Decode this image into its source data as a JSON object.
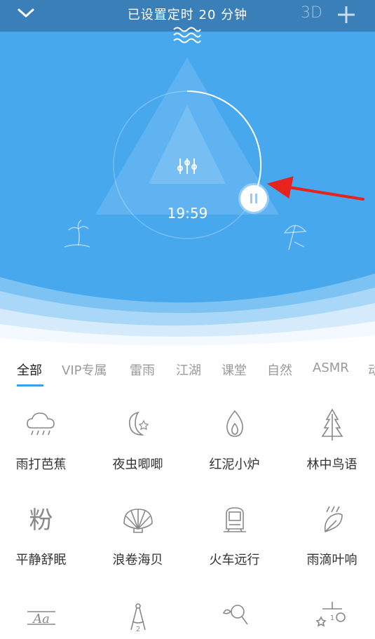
{
  "header": {
    "title": "已设置定时 20 分钟",
    "btn_3d": "3D"
  },
  "player": {
    "time": "19:59"
  },
  "tabs": [
    {
      "label": "全部",
      "active": true
    },
    {
      "label": "VIP专属"
    },
    {
      "label": "雷雨"
    },
    {
      "label": "江湖"
    },
    {
      "label": "课堂"
    },
    {
      "label": "自然"
    },
    {
      "label": "ASMR"
    },
    {
      "label": "动"
    }
  ],
  "sounds": [
    {
      "label": "雨打芭蕉",
      "icon": "cloud-rain-icon"
    },
    {
      "label": "夜虫唧唧",
      "icon": "moon-stars-icon"
    },
    {
      "label": "红泥小炉",
      "icon": "flame-icon"
    },
    {
      "label": "林中鸟语",
      "icon": "pine-tree-icon"
    },
    {
      "label": "平静舒眠",
      "icon": "fen-character-icon",
      "glyph": "粉"
    },
    {
      "label": "浪卷海贝",
      "icon": "seashell-icon"
    },
    {
      "label": "火车远行",
      "icon": "train-icon"
    },
    {
      "label": "雨滴叶响",
      "icon": "rain-leaf-icon"
    },
    {
      "label": "",
      "icon": "handwriting-icon",
      "glyph": "Aa"
    },
    {
      "label": "",
      "icon": "compass-icon",
      "glyph": "2"
    },
    {
      "label": "",
      "icon": "magnifier-icon"
    },
    {
      "label": "",
      "icon": "mobile-toy-icon",
      "glyph": "1"
    }
  ],
  "colors": {
    "hero_blue": "#47a8ee",
    "topbar_blue": "#3b7fb8",
    "accent": "#3aa0ec"
  },
  "annotation": {
    "type": "red-arrow",
    "points_to": "pause-button"
  }
}
